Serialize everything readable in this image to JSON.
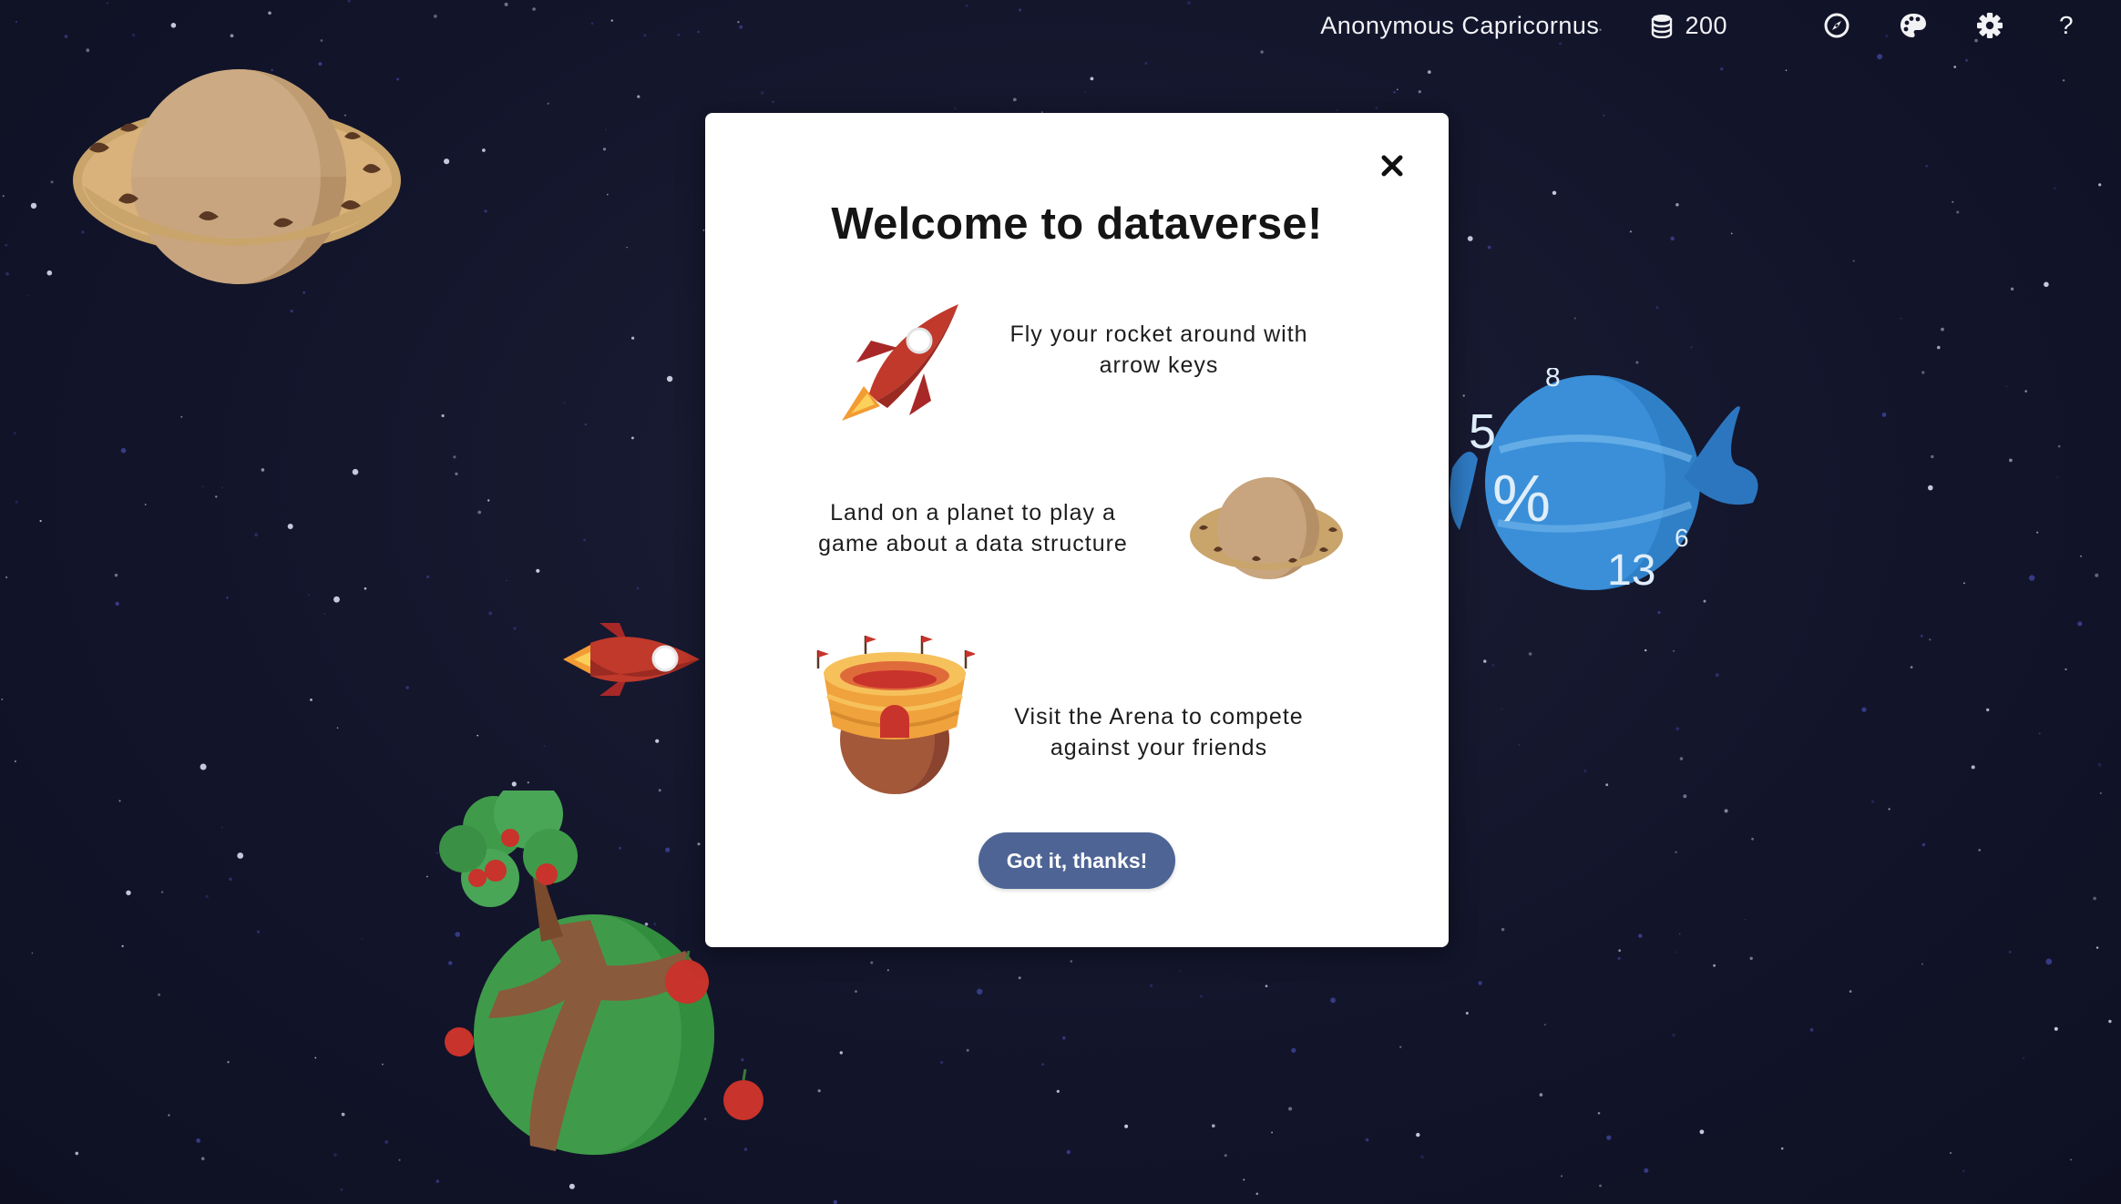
{
  "topbar": {
    "username": "Anonymous Capricornus",
    "coins": "200",
    "coin_icon": "coins-icon",
    "compass_icon": "compass-icon",
    "palette_icon": "palette-icon",
    "settings_icon": "gear-icon",
    "help_label": "?"
  },
  "modal": {
    "title": "Welcome to dataverse!",
    "close_label": "close-icon",
    "rows": [
      {
        "icon": "rocket-icon",
        "text_line1": "Fly your rocket around with",
        "text_line2": "arrow keys"
      },
      {
        "icon": "planet-icon",
        "text_line1": "Land on a planet to play a",
        "text_line2": "game about a data structure"
      },
      {
        "icon": "arena-icon",
        "text_line1": "Visit the Arena to compete",
        "text_line2": "against your friends"
      }
    ],
    "confirm_label": "Got it, thanks!"
  },
  "world": {
    "candy_digits": [
      "8",
      "5",
      "%",
      "6",
      "13"
    ]
  },
  "colors": {
    "background": "#13162a",
    "modal_bg": "#ffffff",
    "button_bg": "#4d6494",
    "rocket_red": "#c0392b",
    "candy_blue": "#3a8fd8",
    "cookie_tan": "#c9a46b",
    "apple_green": "#3f9b4a"
  }
}
